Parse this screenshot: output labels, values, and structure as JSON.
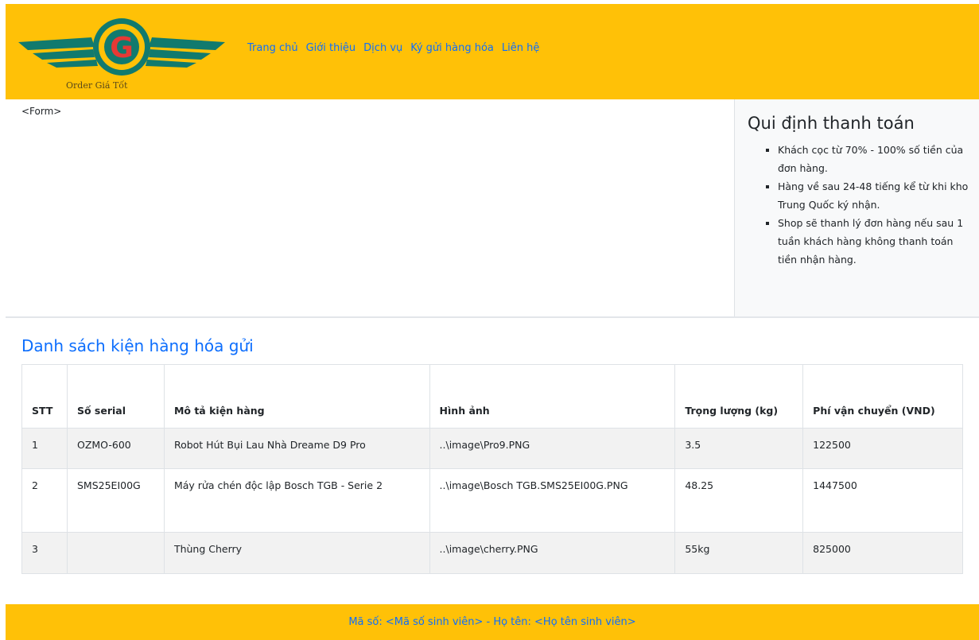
{
  "header": {
    "logo_text": "Order Giá Tốt",
    "logo_letter": "G",
    "nav": [
      "Trang chủ",
      "Giới thiệu",
      "Dịch vụ",
      "Ký gửi hàng hóa",
      "Liên hệ"
    ]
  },
  "form": {
    "placeholder": "<Form>"
  },
  "sidebar": {
    "title": "Qui định thanh toán",
    "rules": [
      "Khách cọc từ 70% - 100% số tiền của đơn hàng.",
      "Hàng về sau 24-48 tiếng kể từ khi kho Trung Quốc ký nhận.",
      "Shop sẽ thanh lý đơn hàng nếu sau 1 tuần khách hàng không thanh toán tiền nhận hàng."
    ]
  },
  "packages": {
    "title": "Danh sách kiện hàng hóa gửi",
    "headers": [
      "STT",
      "Số serial",
      "Mô tả kiện hàng",
      "Hình ảnh",
      "Trọng lượng (kg)",
      "Phí vận chuyển (VND)"
    ],
    "rows": [
      [
        "1",
        "OZMO-600",
        "Robot Hút Bụi Lau Nhà Dreame D9 Pro",
        "..\\image\\Pro9.PNG",
        "3.5",
        "122500"
      ],
      [
        "2",
        "SMS25EI00G",
        "Máy rửa chén độc lập Bosch TGB - Serie 2",
        "..\\image\\Bosch TGB.SMS25EI00G.PNG",
        "48.25",
        "1447500"
      ],
      [
        "3",
        "",
        "Thùng Cherry",
        "..\\image\\cherry.PNG",
        "55kg",
        "825000"
      ]
    ]
  },
  "footer": {
    "text": "Mã số: <Mã số sinh viên> - Họ tên: <Họ tên sinh viên>"
  },
  "colors": {
    "header_bg": "#ffc107",
    "link": "#0d6efd",
    "logo_teal": "#117a6e",
    "logo_red": "#e53935"
  }
}
